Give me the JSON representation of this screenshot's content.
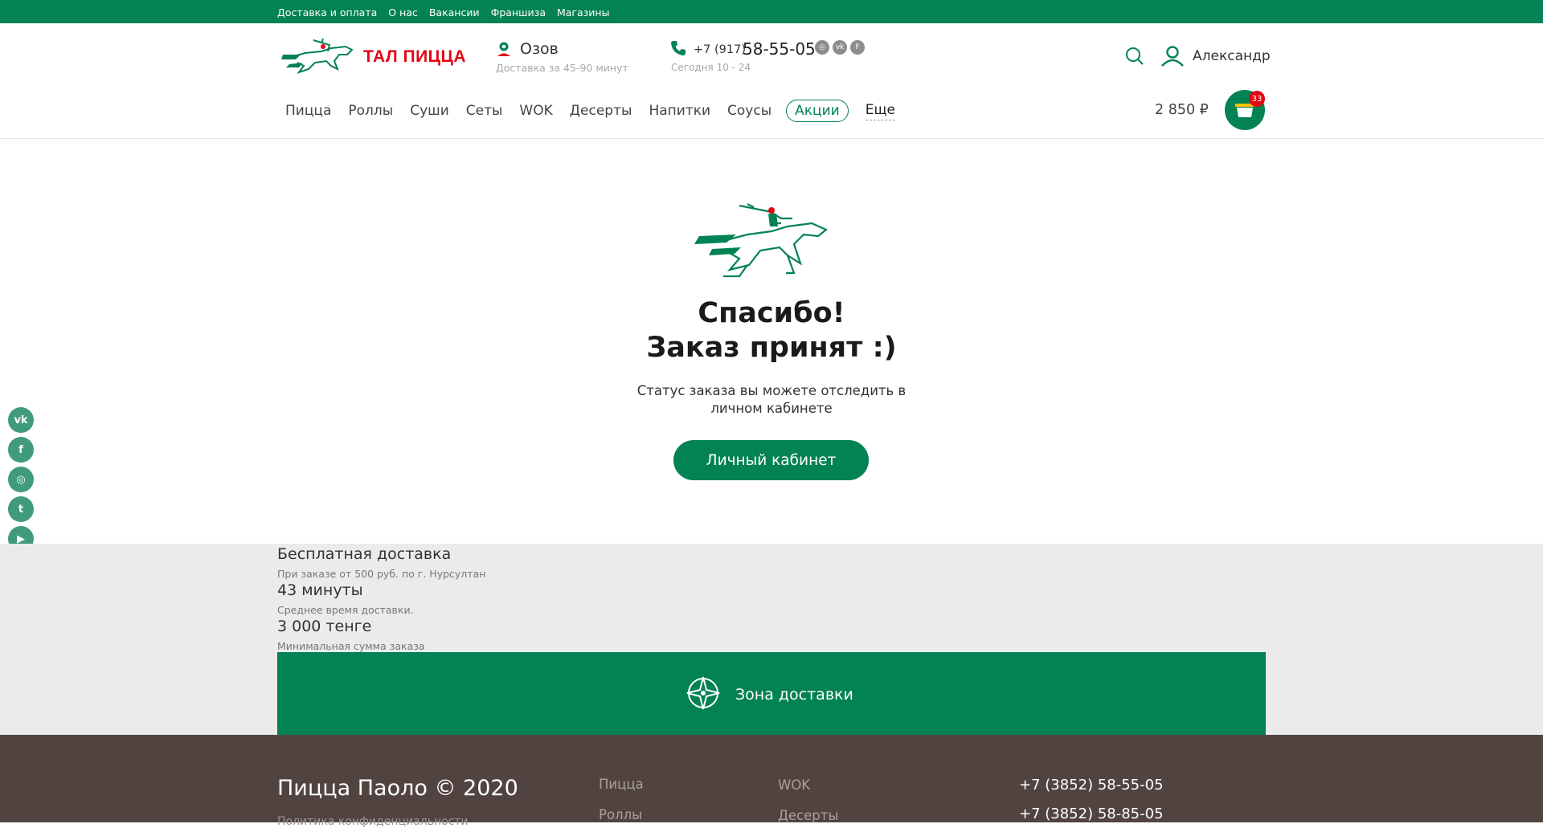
{
  "topbar": {
    "links": [
      "Доставка и оплата",
      "О нас",
      "Вакансии",
      "Франшиза",
      "Магазины"
    ]
  },
  "header": {
    "logo_text": "ТАЛ ПИЦЦА",
    "city": "Озов",
    "delivery_time": "Доставка за 45-90 минут",
    "phone_code": "+7 (917)",
    "phone_number": "58-55-05",
    "hours": "Сегодня 10 - 24",
    "user_name": "Александр"
  },
  "nav": {
    "items": [
      "Пицца",
      "Роллы",
      "Суши",
      "Сеты",
      "WOK",
      "Десерты",
      "Напитки",
      "Соусы"
    ],
    "promo": "Акции",
    "more": "Еще"
  },
  "cart": {
    "sum": "2 850 ₽",
    "count": "33"
  },
  "success": {
    "line1": "Спасибо!",
    "line2": "Заказ принят :)",
    "status_text": "Статус заказа вы можете отследить в личном кабинете",
    "button": "Личный кабинет"
  },
  "side_socials": [
    "vk-icon",
    "facebook-icon",
    "instagram-icon",
    "twitter-icon",
    "youtube-icon"
  ],
  "info": {
    "free_delivery_title": "Бесплатная доставка",
    "free_delivery_sub": "При заказе от 500 руб. по г. Нурсултан",
    "time_title": "43 минуты",
    "time_sub": "Среднее время доставки.",
    "min_title": "3 000 тенге",
    "min_sub": "Минимальная сумма заказа",
    "zone_label": "Зона доставки"
  },
  "footer": {
    "copyright": "Пицца Паоло © 2020",
    "copyright_sub": "Политика конфиденциальности",
    "col1": [
      "Пицца",
      "Роллы"
    ],
    "col2": [
      "WOK",
      "Десерты"
    ],
    "phones": [
      "+7 (3852) 58-55-05",
      "+7 (3852) 58-85-05"
    ]
  },
  "colors": {
    "brand_green": "#038253",
    "logo_red": "#e30613",
    "footer_bg": "#514440",
    "info_bg": "#ebebeb"
  }
}
